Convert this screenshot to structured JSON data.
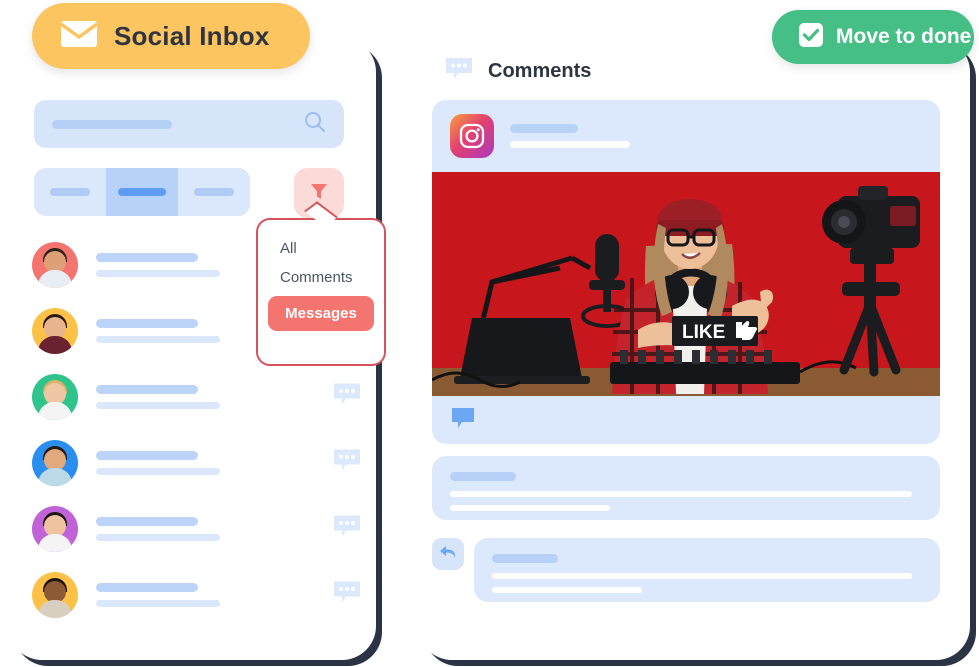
{
  "inbox_badge": {
    "label": "Social Inbox",
    "icon": "envelope-icon",
    "color": "#fcc55f"
  },
  "done_badge": {
    "label": "Move to done",
    "icon": "checkbox-checked-icon",
    "color": "#45bf85"
  },
  "left_panel": {
    "search": {
      "placeholder": "",
      "icon": "search-icon"
    },
    "tabs": [
      {
        "id": "tab-1",
        "label": "",
        "active": false
      },
      {
        "id": "tab-2",
        "label": "",
        "active": true
      },
      {
        "id": "tab-3",
        "label": "",
        "active": false
      }
    ],
    "filter_button": {
      "icon": "filter-funnel-icon",
      "color": "#f4756f",
      "background": "#fbdbd8"
    },
    "dropdown": {
      "open": true,
      "items": [
        {
          "label": "All",
          "selected": false
        },
        {
          "label": "Comments",
          "selected": false
        },
        {
          "label": "Messages",
          "selected": true
        }
      ],
      "selected_color": "#f4756f",
      "border_color": "#d4545a"
    },
    "conversations": [
      {
        "avatar_color": "#f4756f",
        "skin": "#e0a077",
        "hair": "#2f2119",
        "has_bubble": false
      },
      {
        "avatar_color": "#fcc247",
        "skin": "#e8b48e",
        "hair": "#2b1d14",
        "has_bubble": false
      },
      {
        "avatar_color": "#2ec48b",
        "skin": "#f0c6a4",
        "hair": "#d8b36a",
        "has_bubble": true
      },
      {
        "avatar_color": "#2a8ef0",
        "skin": "#e2a97e",
        "hair": "#241a12",
        "has_bubble": true
      },
      {
        "avatar_color": "#c163d8",
        "skin": "#f0c3a0",
        "hair": "#1d1510",
        "has_bubble": true
      },
      {
        "avatar_color": "#fcc247",
        "skin": "#8d5a36",
        "hair": "#201611",
        "has_bubble": true
      }
    ]
  },
  "right_panel": {
    "header": {
      "title": "Comments",
      "icon": "chat-bubble-dots-icon"
    },
    "post": {
      "network": "instagram",
      "network_icon": "instagram-icon",
      "photo_alt": "Content creator in red beanie and plaid shirt holding a LIKE sign with thumbs up, studio microphone, laptop and camera on tripod against red background",
      "footer_icon": "chat-bubble-icon"
    },
    "comments": [
      {
        "id": "comment-1",
        "is_reply": false
      },
      {
        "id": "comment-2",
        "is_reply": true,
        "reply_icon": "reply-arrow-icon"
      }
    ]
  },
  "colors": {
    "card_shadow": "#2b3445",
    "placeholder_blue": "#b4d0f7",
    "panel_blue": "#dce9fc",
    "accent_coral": "#f4756f",
    "accent_green": "#45bf85",
    "accent_amber": "#fcc55f"
  }
}
